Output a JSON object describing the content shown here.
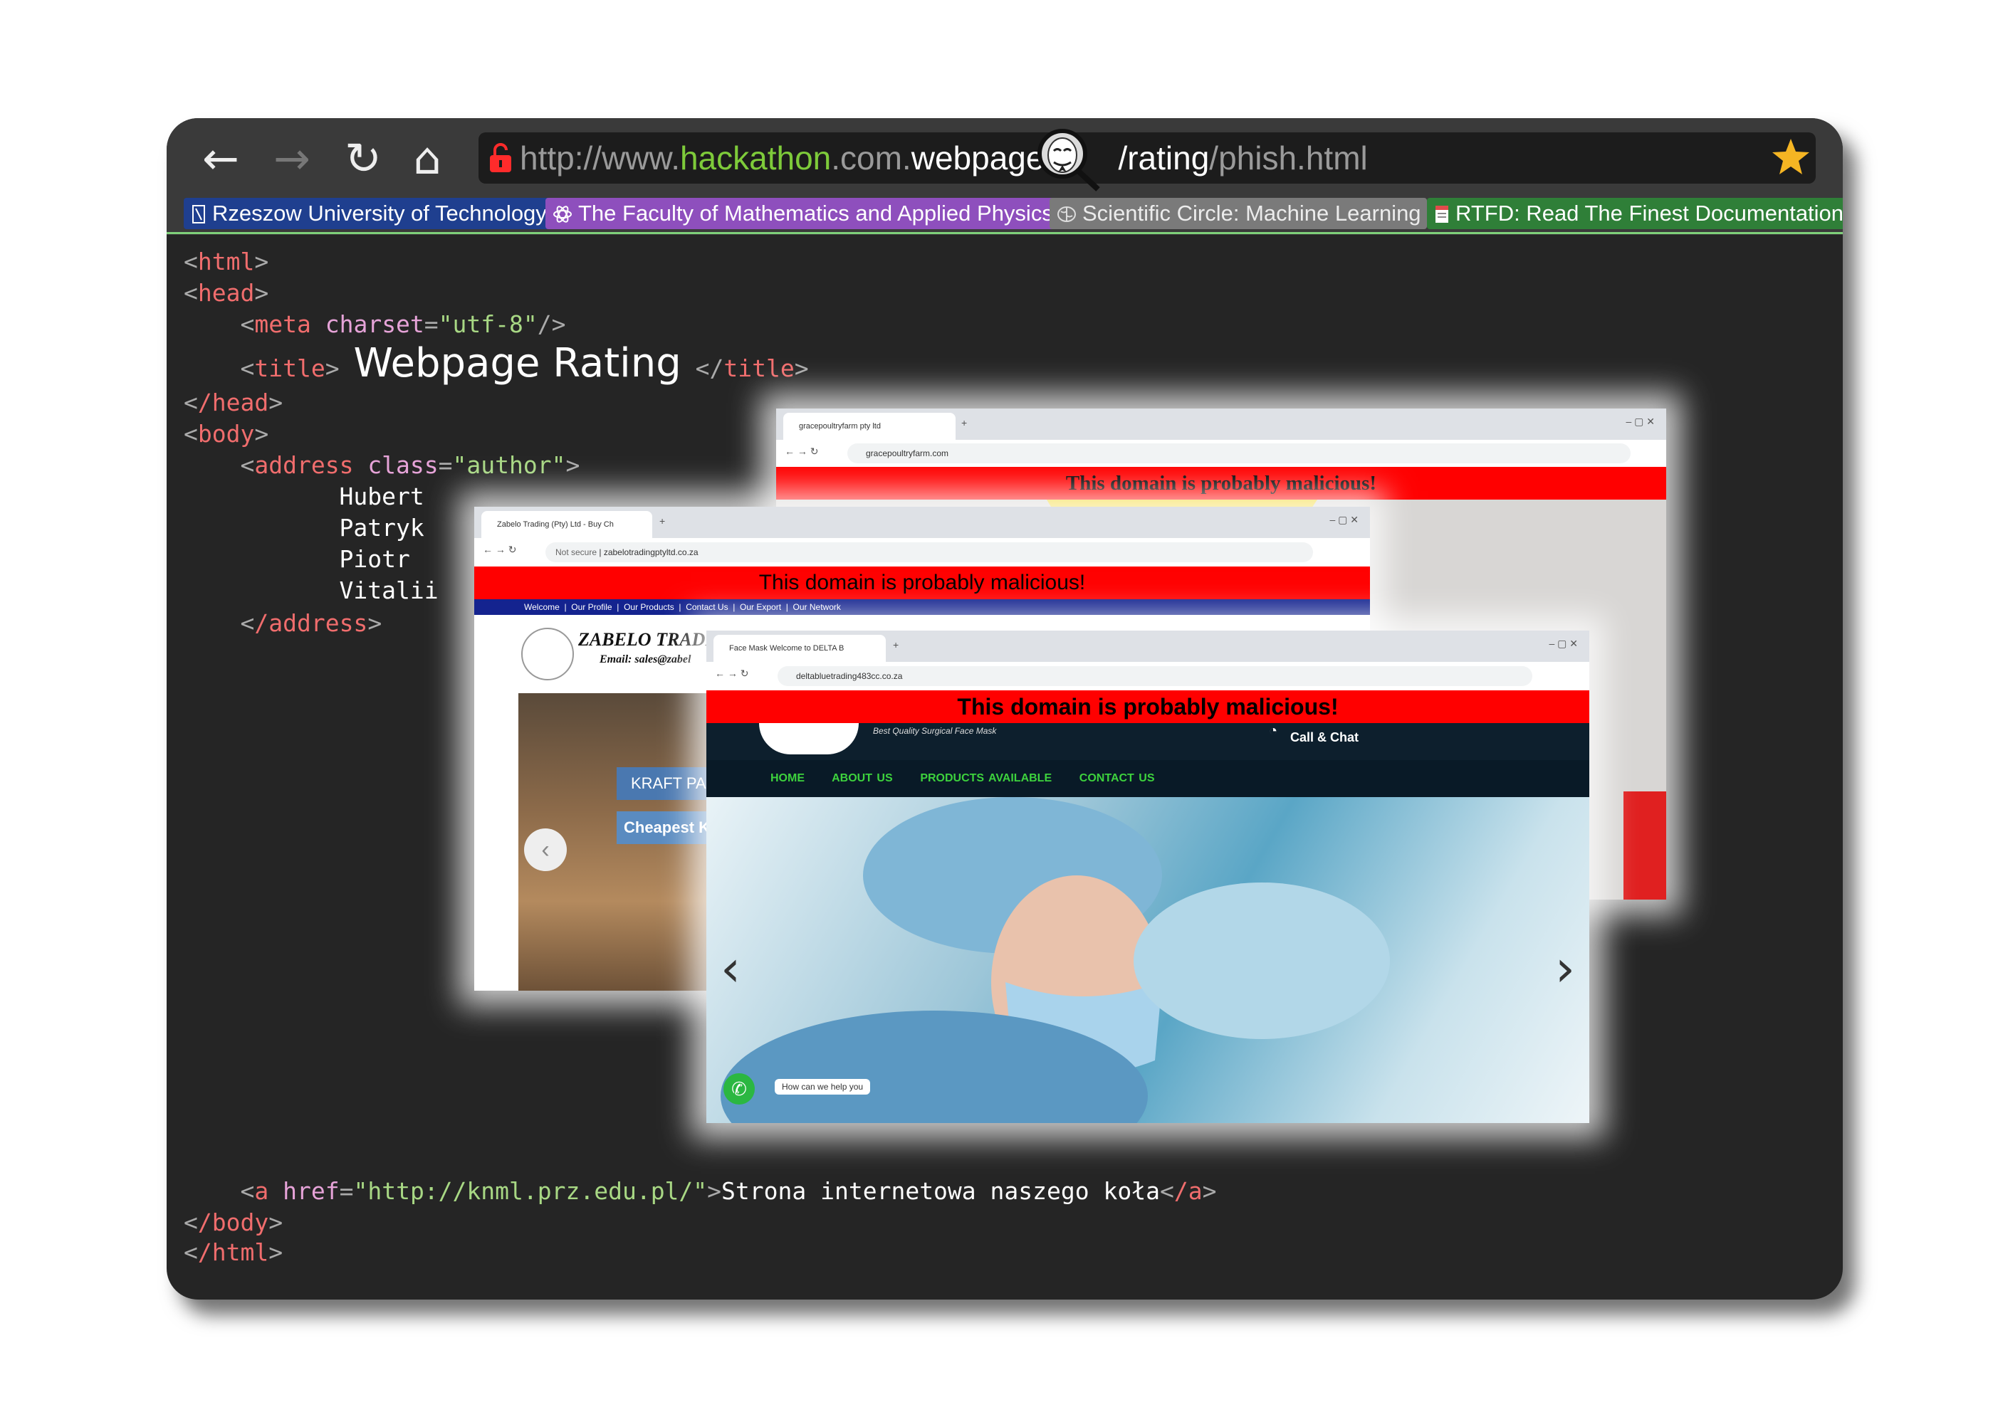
{
  "browser": {
    "back_label": "←",
    "forward_label": "→",
    "reload_label": "↻",
    "home_label": "⌂",
    "url_scheme": "http://www.",
    "url_domain": "hackathon",
    "url_mid": ".com.",
    "url_webpage": "webpage",
    "url_path": "/rating",
    "url_file": "/phish.html",
    "icons": [
      "lock-icon",
      "anonymous-mask-icon",
      "star-icon"
    ]
  },
  "bookmarks": [
    {
      "label": "Rzeszow University of Technology",
      "color": "#1f3f8f",
      "icon": "bookmark-icon"
    },
    {
      "label": "The Faculty of Mathematics and Applied Physics",
      "color": "#8e4fbd",
      "icon": "atom-icon"
    },
    {
      "label": "Scientific Circle: Machine Learning",
      "color": "#7a7a7a",
      "icon": "brain-icon"
    },
    {
      "label": "RTFD: Read The Finest Documentation",
      "color": "#2f7f38",
      "icon": "document-icon"
    }
  ],
  "code": {
    "html_open": "html",
    "head_open": "head",
    "meta_tag": "meta",
    "meta_attr": "charset",
    "meta_value": "\"utf-8\"",
    "title_tag": "title",
    "title_text": "Webpage Rating",
    "head_close": "/head",
    "body_open": "body",
    "address_tag": "address",
    "address_attr": "class",
    "address_value": "\"author\"",
    "authors": [
      "Hubert",
      "Patryk",
      "Piotr",
      "Vitalii"
    ],
    "address_close": "/address",
    "a_tag": "a",
    "a_attr": "href",
    "a_value": "\"http://knml.prz.edu.pl/\"",
    "a_text": "Strona internetowa naszego koła",
    "a_close": "/a",
    "body_close": "/body",
    "html_close": "/html"
  },
  "screenshots": {
    "warning": "This domain is probably malicious!",
    "shot1": {
      "tab_title": "gracepoultryfarm pty ltd",
      "url": "gracepoultryfarm.com"
    },
    "shot2": {
      "tab_title": "Zabelo Trading (Pty) Ltd - Buy Ch",
      "not_secure": "Not secure",
      "url": "zabelotradingptyltd.co.za",
      "nav": [
        "Welcome",
        "Our Profile",
        "Our Products",
        "Contact Us",
        "Our Export",
        "Our Network"
      ],
      "company": "ZABELO TRADI",
      "email": "Email: sales@zabel",
      "slide_title": "KRAFT PA",
      "slide_sub": "Cheapest K"
    },
    "shot3": {
      "tab_title": "Face Mask Welcome to DELTA B",
      "url": "deltabluetrading483cc.co.za",
      "tagline": "Best Quality Surgical Face Mask",
      "call": "Call & Chat",
      "nav": [
        "HOME",
        "ABOUT US",
        "PRODUCTS AVAILABLE",
        "CONTACT US"
      ],
      "chat": "How can we help you"
    }
  }
}
